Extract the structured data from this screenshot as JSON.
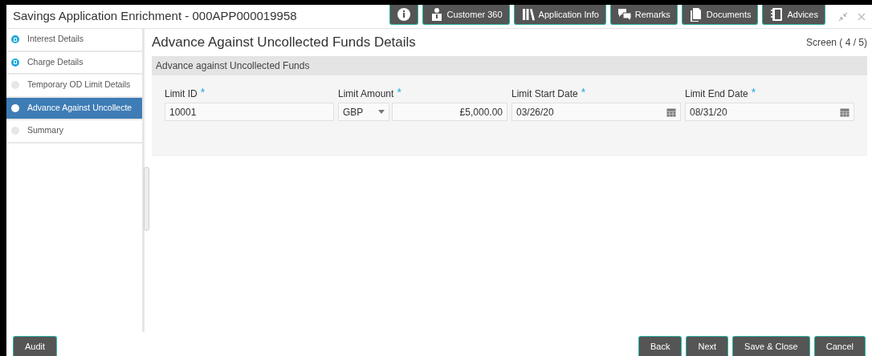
{
  "window": {
    "title": "Savings Application Enrichment - 000APP000019958"
  },
  "toolbar": [
    {
      "kind": "info"
    },
    {
      "kind": "customer",
      "label": "Customer 360"
    },
    {
      "kind": "books",
      "label": "Application Info"
    },
    {
      "kind": "chat",
      "label": "Remarks"
    },
    {
      "kind": "document",
      "label": "Documents"
    },
    {
      "kind": "notebook",
      "label": "Advices"
    }
  ],
  "steps": [
    {
      "label": "Interest Details",
      "completed": true,
      "selected": false
    },
    {
      "label": "Charge Details",
      "completed": true,
      "selected": false
    },
    {
      "label": "Temporary OD Limit Details",
      "completed": false,
      "selected": false
    },
    {
      "label": "Advance Against Uncollecte",
      "completed": false,
      "selected": true
    },
    {
      "label": "Summary",
      "completed": false,
      "selected": false
    }
  ],
  "page": {
    "heading": "Advance Against Uncollected Funds Details",
    "screen_counter": "Screen ( 4 / 5)",
    "section": "Advance against Uncollected Funds"
  },
  "fields": [
    {
      "kind": "text",
      "label": "Limit ID",
      "required_mark": "*",
      "value": "10001"
    },
    {
      "kind": "amount",
      "label": "Limit Amount",
      "required_mark": "*",
      "currency": "GBP",
      "value": "£5,000.00"
    },
    {
      "kind": "date",
      "label": "Limit Start Date",
      "required_mark": "*",
      "value": "03/26/20"
    },
    {
      "kind": "date",
      "label": "Limit End Date",
      "required_mark": "*",
      "value": "08/31/20"
    }
  ],
  "footer": {
    "left_buttons": [
      "Audit"
    ],
    "right_buttons": [
      "Back",
      "Next",
      "Save & Close",
      "Cancel"
    ]
  }
}
